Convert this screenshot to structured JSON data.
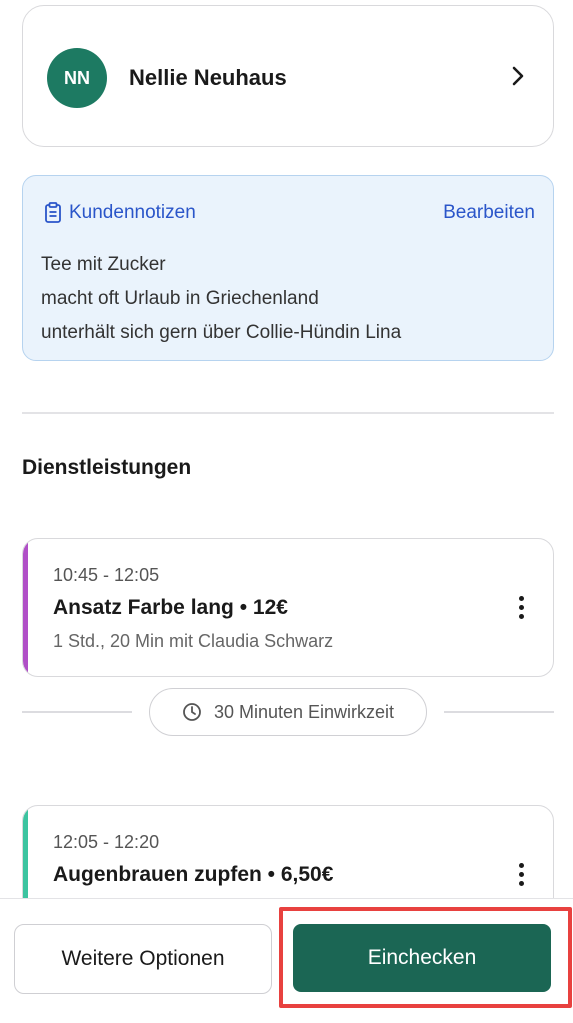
{
  "client": {
    "initials": "NN",
    "name": "Nellie Neuhaus",
    "avatar_color": "#1d7a62"
  },
  "notes": {
    "title": "Kundennotizen",
    "edit_label": "Bearbeiten",
    "accent_color": "#2a55c9",
    "lines": [
      "Tee mit Zucker",
      "macht oft Urlaub in Griechenland",
      "unterhält sich gern über  Collie-Hündin Lina"
    ]
  },
  "services_section": {
    "title": "Dienstleistungen",
    "items": [
      {
        "time": "10:45 - 12:05",
        "title": "Ansatz Farbe lang • 12€",
        "meta": "1 Std., 20 Min mit Claudia Schwarz",
        "accent_color": "#b04fc7"
      },
      {
        "time": "12:05 - 12:20",
        "title": "Augenbrauen zupfen • 6,50€",
        "meta": "",
        "accent_color": "#3cc4a0"
      }
    ],
    "wait_label": "30 Minuten Einwirkzeit"
  },
  "actions": {
    "more_options_label": "Weitere Optionen",
    "checkin_label": "Einchecken",
    "primary_color": "#1b6654",
    "highlight_color": "#e8413f"
  },
  "icons": {
    "chevron": "chevron-right-icon",
    "notes": "clipboard-icon",
    "wait": "clock-icon",
    "menu": "more-vertical-icon"
  }
}
